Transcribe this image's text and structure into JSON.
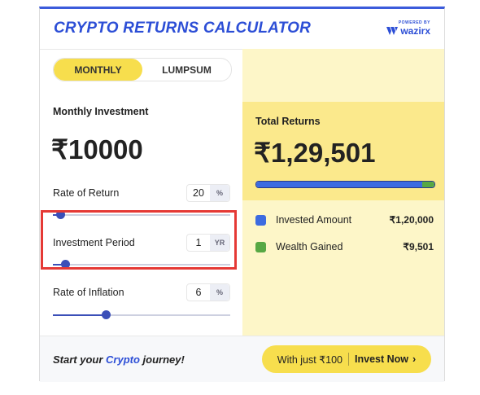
{
  "header": {
    "title": "CRYPTO RETURNS CALCULATOR",
    "powered_by": "POWERED BY",
    "brand": "wazirx"
  },
  "mode_tabs": [
    {
      "label": "MONTHLY",
      "active": true
    },
    {
      "label": "LUMPSUM",
      "active": false
    }
  ],
  "investment": {
    "label": "Monthly Investment",
    "value": "₹10000"
  },
  "rate_of_return": {
    "label": "Rate of Return",
    "value": "20",
    "unit": "%",
    "slider_fraction": 0.04
  },
  "investment_period": {
    "label": "Investment Period",
    "value": "1",
    "unit": "YR",
    "slider_fraction": 0.07
  },
  "rate_of_inflation": {
    "label": "Rate of Inflation",
    "value": "6",
    "unit": "%",
    "slider_fraction": 0.3
  },
  "results": {
    "total_label": "Total Returns",
    "total_value": "₹1,29,501",
    "invested_label": "Invested Amount",
    "invested_value": "₹1,20,000",
    "gained_label": "Wealth Gained",
    "gained_value": "₹9,501",
    "invested_fraction": 0.93
  },
  "colors": {
    "accent_blue": "#2c4ed6",
    "yellow": "#f7de4d",
    "invested": "#3c6be0",
    "gained": "#57a844",
    "highlight": "#e53935"
  },
  "footer": {
    "text_pre": "Start your ",
    "text_blue": "Crypto",
    "text_post": " journey!",
    "button_left": "With just ₹100",
    "button_right": "Invest Now"
  }
}
